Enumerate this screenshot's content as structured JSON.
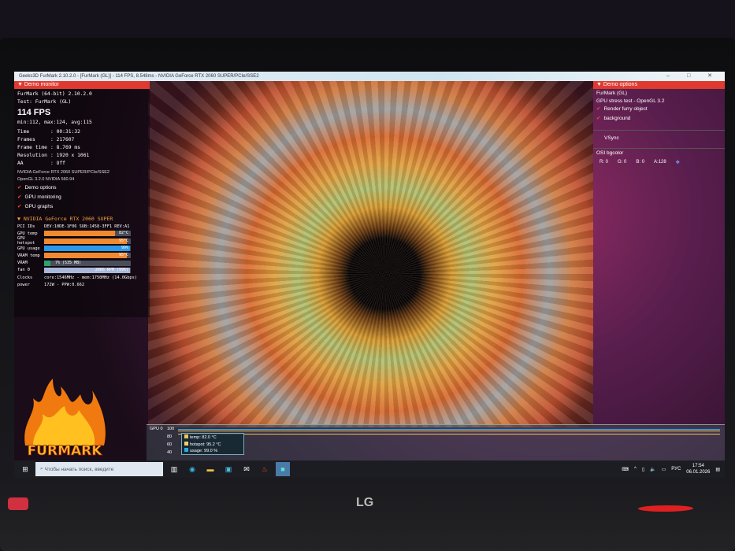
{
  "window": {
    "title": "Geeks3D FurMark 2.10.2.0 - [FurMark (GL)] - 114 FPS, 8.548ms - NVIDIA GeForce RTX 2060 SUPER/PCIe/SSE2",
    "controls": "–  □  ✕"
  },
  "monitor": {
    "header": "Demo monitor",
    "app": "FurMark (64-bit) 2.10.2.0",
    "test": "Test: FurMark (GL)",
    "fps": "114 FPS",
    "fps_stats": "min:112, max:124, avg:115",
    "stats": [
      {
        "k": "Time",
        "v": ": 00:31:32"
      },
      {
        "k": "Frames",
        "v": ": 217607"
      },
      {
        "k": "Frame time",
        "v": ": 8.769 ms"
      },
      {
        "k": "Resolution",
        "v": ": 1920 x 1061"
      },
      {
        "k": "AA",
        "v": ": Off"
      }
    ],
    "renderer": "NVIDIA GeForce RTX 2060 SUPER/PCIe/SSE2",
    "opengl": "OpenGL 3.2.0 NVIDIA 560.94",
    "checks": [
      "Demo options",
      "GPU monitoring",
      "GPU graphs"
    ]
  },
  "gpu": {
    "header": "NVIDIA GeForce RTX 2060 SUPER",
    "pci_label": "PCI IDs",
    "pci": "DEV:10DE-1F06 SUB:1458-3FF1 REV:A1",
    "bars": [
      {
        "k": "GPU temp",
        "t": "82°C",
        "pct": 82,
        "color": "#f08a30"
      },
      {
        "k": "GPU hotspot",
        "t": "95°C",
        "pct": 95,
        "color": "#f08a30"
      },
      {
        "k": "GPU usage",
        "t": "99%",
        "pct": 99,
        "color": "#2a9ae8"
      },
      {
        "k": "VRAM temp",
        "t": "95°C",
        "pct": 95,
        "color": "#f08a30"
      },
      {
        "k": "VRAM",
        "t": "7% (535 MB)",
        "pct": 7,
        "color": "#30a070"
      },
      {
        "k": "fan 0",
        "t": "2066 RPM (99%)",
        "pct": 99,
        "color": "#a8b8d8"
      }
    ],
    "clocks_label": "Clocks",
    "clocks": "core:1546MHz - mem:1750MHz (14.0Gbps)",
    "power_label": "power",
    "power": "172W - PPW:0.662"
  },
  "options": {
    "header": "Demo options",
    "title": "FurMark (GL)",
    "subtitle": "GPU stress test - OpenGL 3.2",
    "checks": [
      "Render furry object",
      "background"
    ],
    "vsync": "VSync",
    "osi_label": "OSI bgcolor",
    "osi": [
      "R: 0",
      "G: 0",
      "B: 0",
      "A:128"
    ]
  },
  "graph": {
    "label": "GPU 0",
    "ticks": [
      "100",
      "80",
      "60",
      "40"
    ],
    "legend": [
      {
        "t": "temp: 82.0 °C",
        "c": "#f0c060"
      },
      {
        "t": "hotspot: 95.2 °C",
        "c": "#f0d070"
      },
      {
        "t": "usage: 99.0 %",
        "c": "#30a8e0"
      }
    ]
  },
  "logo": "FURMARK",
  "taskbar": {
    "search": "Чтобы начать поиск, введите",
    "lang": "РУС",
    "time": "17:54",
    "date": "06.01.2026"
  },
  "monitor_brand": "LG"
}
